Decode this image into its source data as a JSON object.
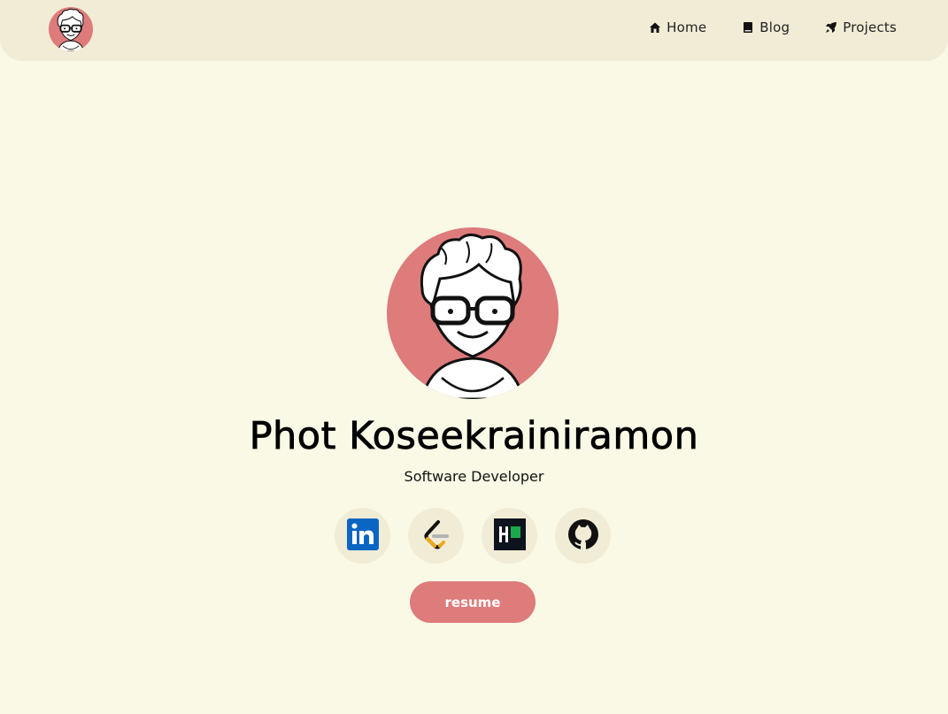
{
  "nav": {
    "avatar_icon": "cartoon-avatar-icon",
    "links": [
      {
        "label": "Home",
        "icon": "house-icon"
      },
      {
        "label": "Blog",
        "icon": "book-icon"
      },
      {
        "label": "Projects",
        "icon": "rocket-icon"
      }
    ]
  },
  "profile": {
    "name": "Phot Koseekrainiramon",
    "role": "Software Developer"
  },
  "socials": [
    {
      "icon": "linkedin-icon"
    },
    {
      "icon": "leetcode-icon"
    },
    {
      "icon": "hackerrank-icon"
    },
    {
      "icon": "github-icon"
    }
  ],
  "resume": {
    "label": "resume"
  },
  "colors": {
    "background": "#f9f9e5",
    "navbar": "#f1ecd6",
    "accent": "#de7b7b"
  }
}
